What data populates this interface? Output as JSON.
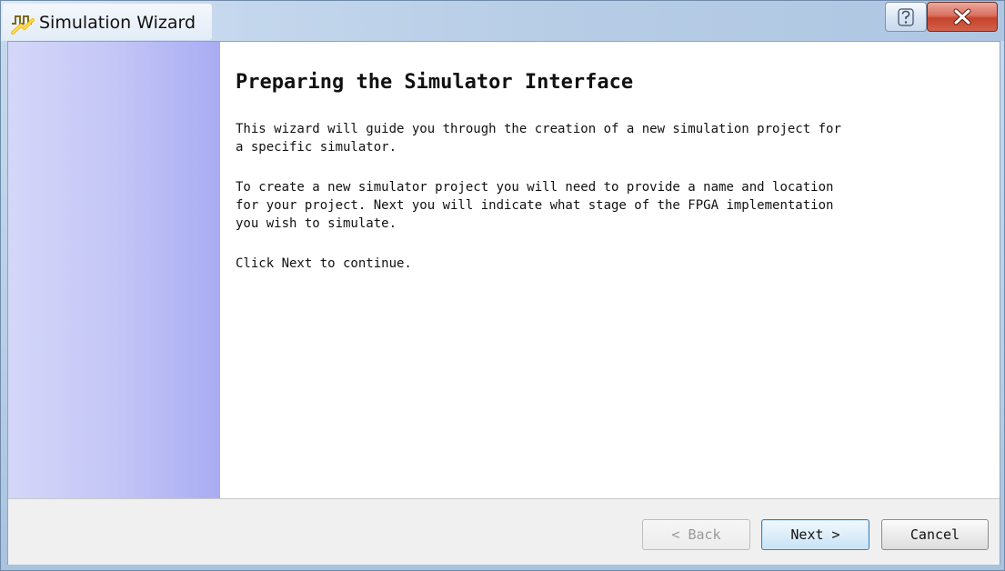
{
  "window": {
    "title": "Simulation Wizard",
    "icon": "waveform-app-icon",
    "help_icon": "help-question-icon",
    "close_icon": "close-x-icon"
  },
  "page": {
    "heading": "Preparing the Simulator Interface",
    "paragraph_1": "This wizard will guide you through the creation of a new simulation project for\na specific simulator.",
    "paragraph_2": "To create a new simulator project you will need to provide a name and location\nfor your project. Next you will indicate what stage of the FPGA implementation\nyou wish to simulate.",
    "paragraph_3": "Click Next to continue."
  },
  "buttons": {
    "back_label": "< Back",
    "next_label": "Next >",
    "cancel_label": "Cancel"
  },
  "colors": {
    "side_panel_light": "#d4d7f8",
    "side_panel_dark": "#a9acf2",
    "close_button": "#c7432b",
    "default_button_border": "#3c7fb1"
  }
}
